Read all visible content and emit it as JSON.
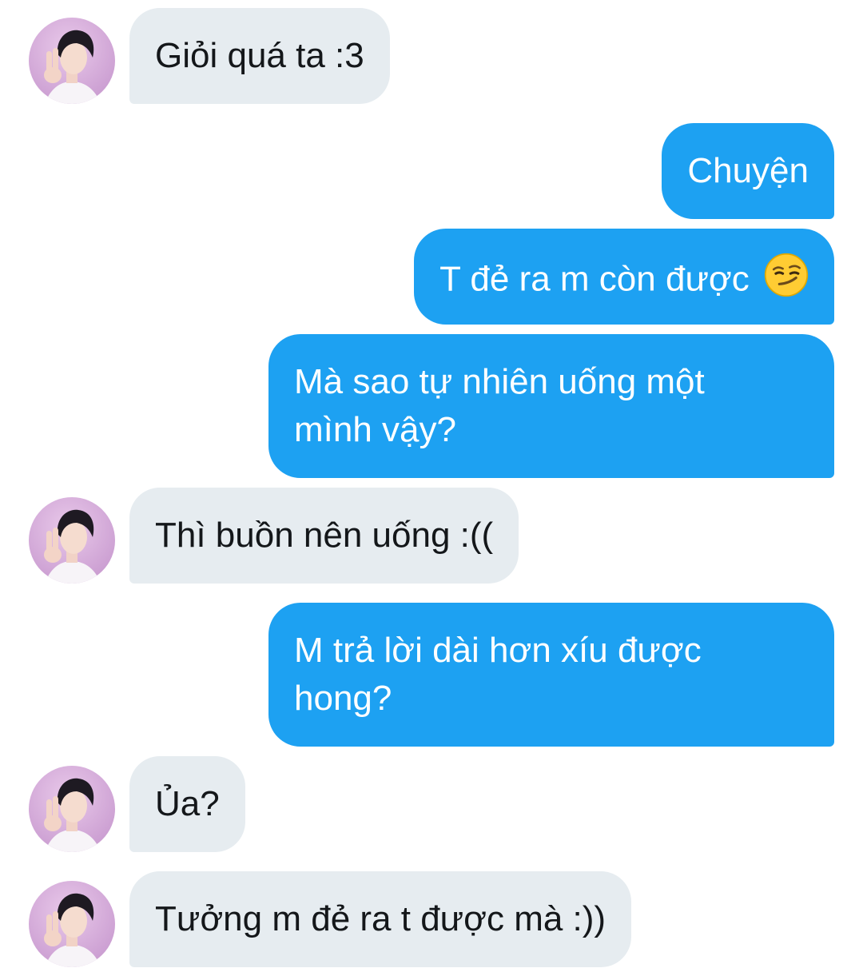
{
  "conversation": {
    "messages": [
      {
        "sender": "them",
        "text": "Giỏi quá ta :3"
      },
      {
        "sender": "me",
        "text": "Chuyện"
      },
      {
        "sender": "me",
        "text": "T đẻ ra m còn được",
        "emoji": "smirking-face"
      },
      {
        "sender": "me",
        "lines": [
          "Mà sao tự nhiên uống một",
          "mình vậy?"
        ]
      },
      {
        "sender": "them",
        "text": "Thì buồn nên uống :(("
      },
      {
        "sender": "me",
        "lines": [
          "M trả lời dài hơn xíu được",
          "hong?"
        ]
      },
      {
        "sender": "them",
        "text": "Ủa?"
      },
      {
        "sender": "them",
        "text": "Tưởng m đẻ ra t được mà :))"
      }
    ]
  },
  "colors": {
    "outgoing_bubble": "#1da1f2",
    "incoming_bubble": "#e6ecf0",
    "incoming_text": "#14171a",
    "outgoing_text": "#ffffff"
  }
}
